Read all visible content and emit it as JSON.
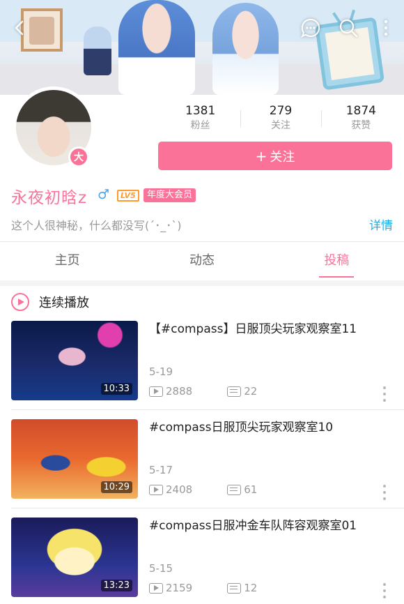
{
  "header": {
    "back": "back",
    "icons": [
      "back-icon",
      "message-icon",
      "search-icon",
      "more-icon"
    ]
  },
  "profile": {
    "avatar_badge": "大",
    "stats": [
      {
        "value": "1381",
        "label": "粉丝"
      },
      {
        "value": "279",
        "label": "关注"
      },
      {
        "value": "1874",
        "label": "获赞"
      }
    ],
    "follow_plus": "+",
    "follow_label": "关注",
    "username": "永夜初晗z",
    "gender": "♂",
    "level": "LV5",
    "vip": "年度大会员",
    "bio": "这个人很神秘，什么都没写(´･_･`)",
    "details": "详情"
  },
  "tabs": [
    {
      "label": "主页",
      "active": false
    },
    {
      "label": "动态",
      "active": false
    },
    {
      "label": "投稿",
      "active": true
    }
  ],
  "playall": {
    "label": "连续播放"
  },
  "videos": [
    {
      "title": "【#compass】日服顶尖玩家观察室11",
      "duration": "10:33",
      "date": "5-19",
      "views": "2888",
      "danmaku": "22"
    },
    {
      "title": "#compass日服顶尖玩家观察室10",
      "duration": "10:29",
      "date": "5-17",
      "views": "2408",
      "danmaku": "61"
    },
    {
      "title": "#compass日服冲金车队阵容观察室01",
      "duration": "13:23",
      "date": "5-15",
      "views": "2159",
      "danmaku": "12"
    }
  ],
  "colors": {
    "accent": "#fb7299",
    "link": "#23ade5",
    "level": "#ff9a2e",
    "gender": "#4ba4e7"
  }
}
